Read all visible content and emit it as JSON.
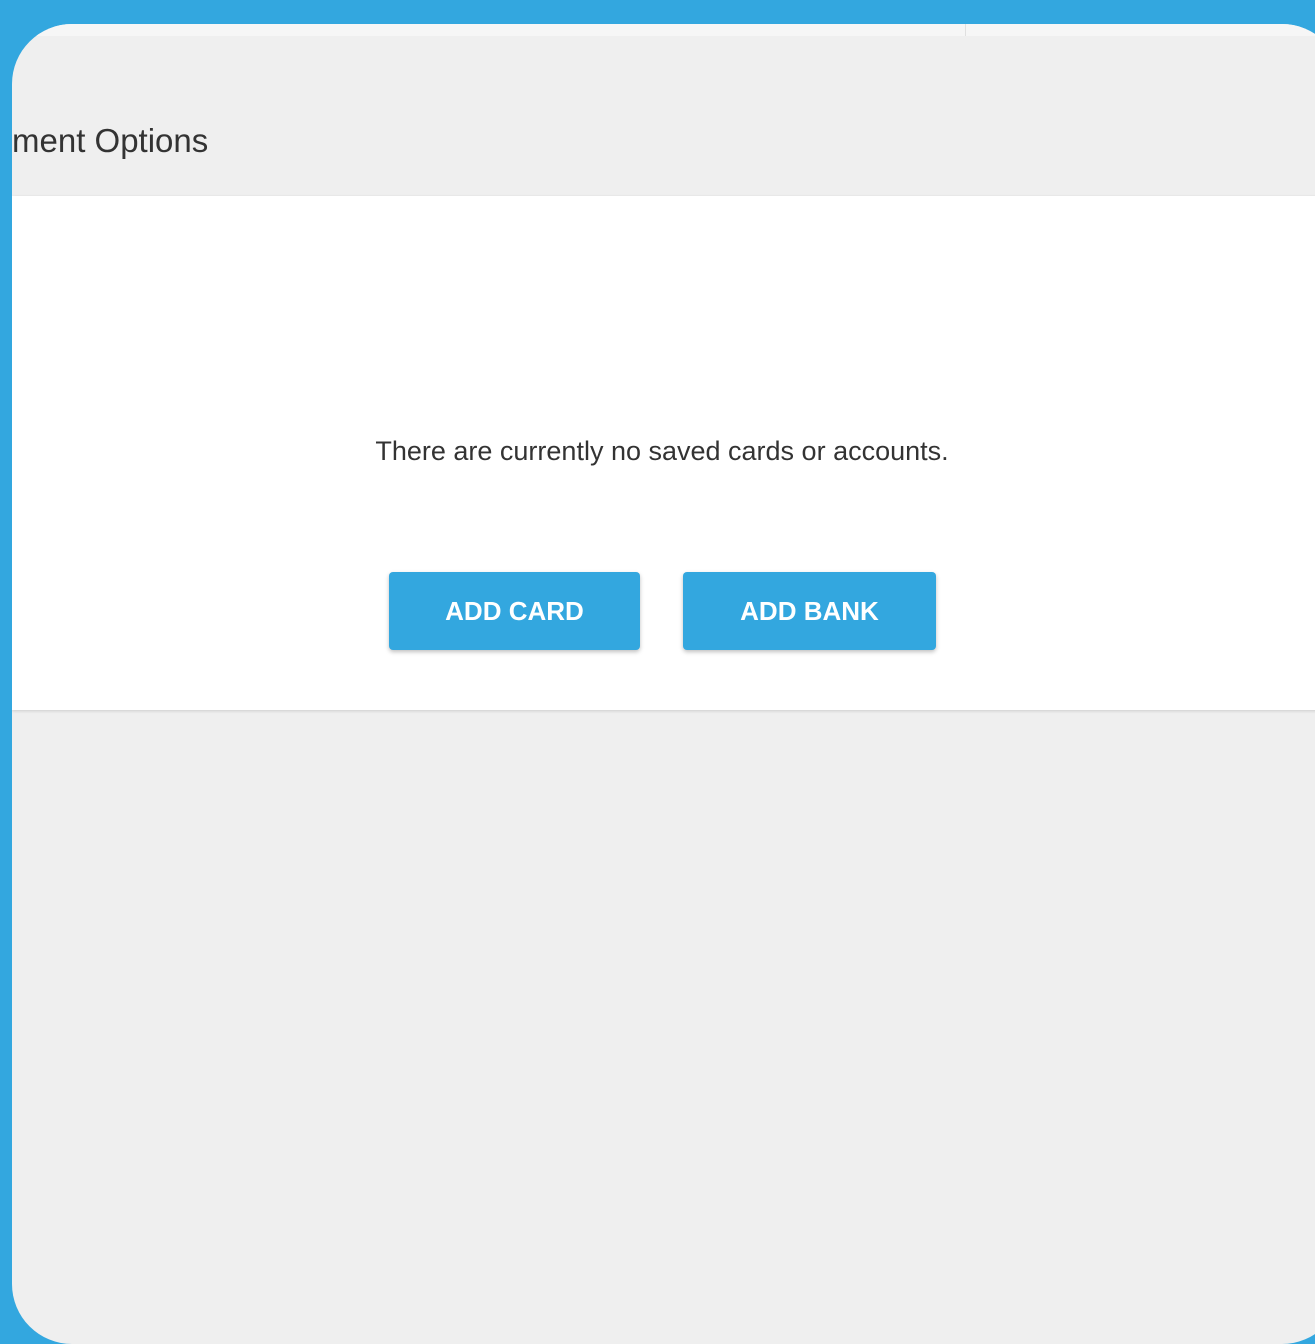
{
  "page": {
    "title": "ment Options"
  },
  "empty_state": {
    "message": "There are currently no saved cards or accounts."
  },
  "actions": {
    "add_card_label": "ADD CARD",
    "add_bank_label": "ADD BANK"
  },
  "colors": {
    "accent": "#33a7df",
    "background": "#efefef",
    "panel": "#ffffff",
    "text": "#333333"
  }
}
